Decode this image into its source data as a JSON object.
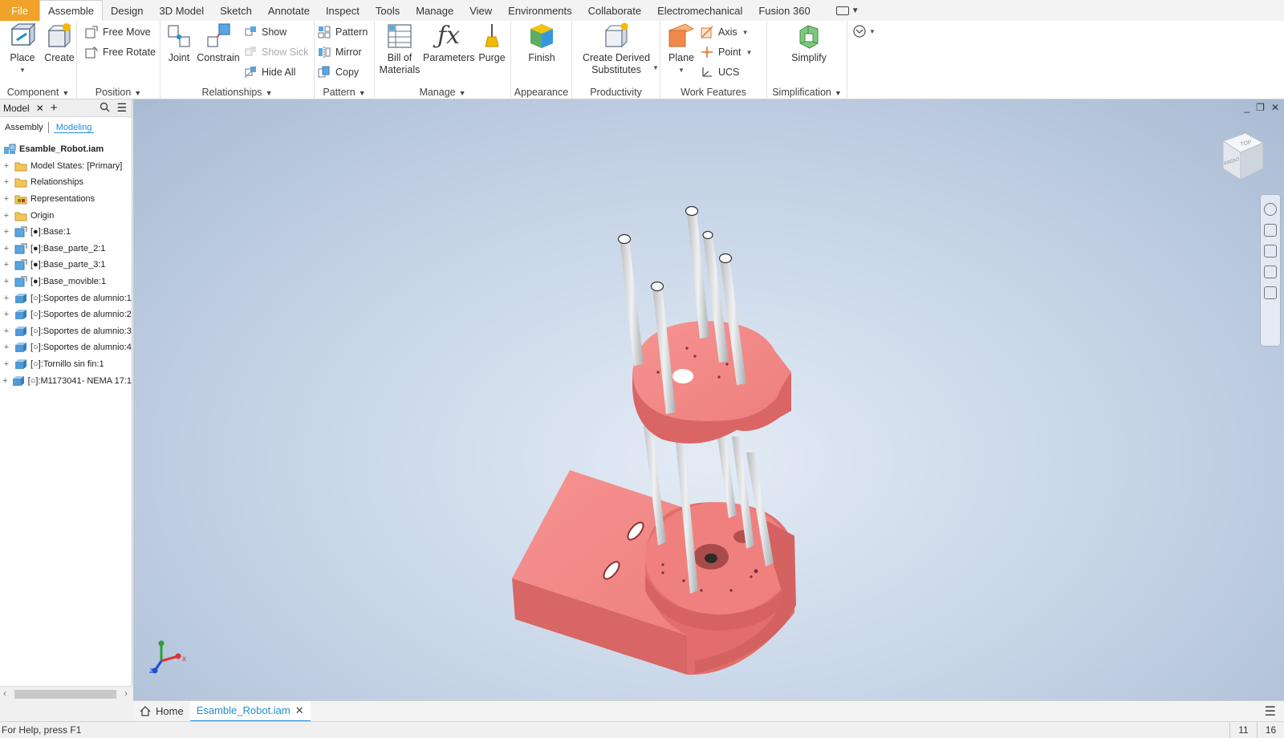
{
  "menu": {
    "tabs": [
      "File",
      "Assemble",
      "Design",
      "3D Model",
      "Sketch",
      "Annotate",
      "Inspect",
      "Tools",
      "Manage",
      "View",
      "Environments",
      "Collaborate",
      "Electromechanical",
      "Fusion 360"
    ],
    "active": "Assemble"
  },
  "ribbon": {
    "component": {
      "title": "Component",
      "place": "Place",
      "create": "Create"
    },
    "position": {
      "title": "Position",
      "free_move": "Free Move",
      "free_rotate": "Free Rotate"
    },
    "relationships": {
      "title": "Relationships",
      "joint": "Joint",
      "constrain": "Constrain",
      "show": "Show",
      "show_sick": "Show Sick",
      "hide_all": "Hide All"
    },
    "pattern": {
      "title": "Pattern",
      "pattern": "Pattern",
      "mirror": "Mirror",
      "copy": "Copy"
    },
    "manage": {
      "title": "Manage",
      "bom_line1": "Bill of",
      "bom_line2": "Materials",
      "parameters": "Parameters",
      "purge": "Purge"
    },
    "appearance": {
      "title": "Appearance",
      "finish": "Finish"
    },
    "productivity": {
      "title": "Productivity",
      "cds_line1": "Create Derived",
      "cds_line2": "Substitutes"
    },
    "work_features": {
      "title": "Work Features",
      "plane": "Plane",
      "axis": "Axis",
      "point": "Point",
      "ucs": "UCS"
    },
    "simplification": {
      "title": "Simplification",
      "simplify": "Simplify"
    }
  },
  "browser": {
    "header": "Model",
    "tab_assembly": "Assembly",
    "tab_modeling": "Modeling",
    "root": "Esamble_Robot.iam",
    "items": [
      {
        "label": "Model States: [Primary]",
        "icon": "folder-icon"
      },
      {
        "label": "Relationships",
        "icon": "folder-icon"
      },
      {
        "label": "Representations",
        "icon": "representations-icon"
      },
      {
        "label": "Origin",
        "icon": "folder-icon"
      },
      {
        "label": "[●]:Base:1",
        "icon": "part-icon"
      },
      {
        "label": "[●]:Base_parte_2:1",
        "icon": "part-icon"
      },
      {
        "label": "[●]:Base_parte_3:1",
        "icon": "part-icon"
      },
      {
        "label": "[●]:Base_movible:1",
        "icon": "part-icon"
      },
      {
        "label": "[○]:Soportes de alumnio:1",
        "icon": "cube-icon"
      },
      {
        "label": "[○]:Soportes de alumnio:2",
        "icon": "cube-icon"
      },
      {
        "label": "[○]:Soportes de alumnio:3",
        "icon": "cube-icon"
      },
      {
        "label": "[○]:Soportes de alumnio:4",
        "icon": "cube-icon"
      },
      {
        "label": "[○]:Tornillo sin fin:1",
        "icon": "cube-icon"
      },
      {
        "label": "[○]:M1173041- NEMA 17:1",
        "icon": "cube-icon"
      }
    ]
  },
  "viewcube": {
    "top": "TOP",
    "front": "FRONT"
  },
  "triad": {
    "x": "x",
    "z": "z"
  },
  "doctabs": {
    "home": "Home",
    "active_doc": "Esamble_Robot.iam"
  },
  "status": {
    "help": "For Help, press F1",
    "n1": "11",
    "n2": "16"
  },
  "colors": {
    "part": "#f07a78",
    "rod": "#d9dbdd",
    "accent": "#1f8dd6",
    "file_tab": "#f0a22a"
  }
}
